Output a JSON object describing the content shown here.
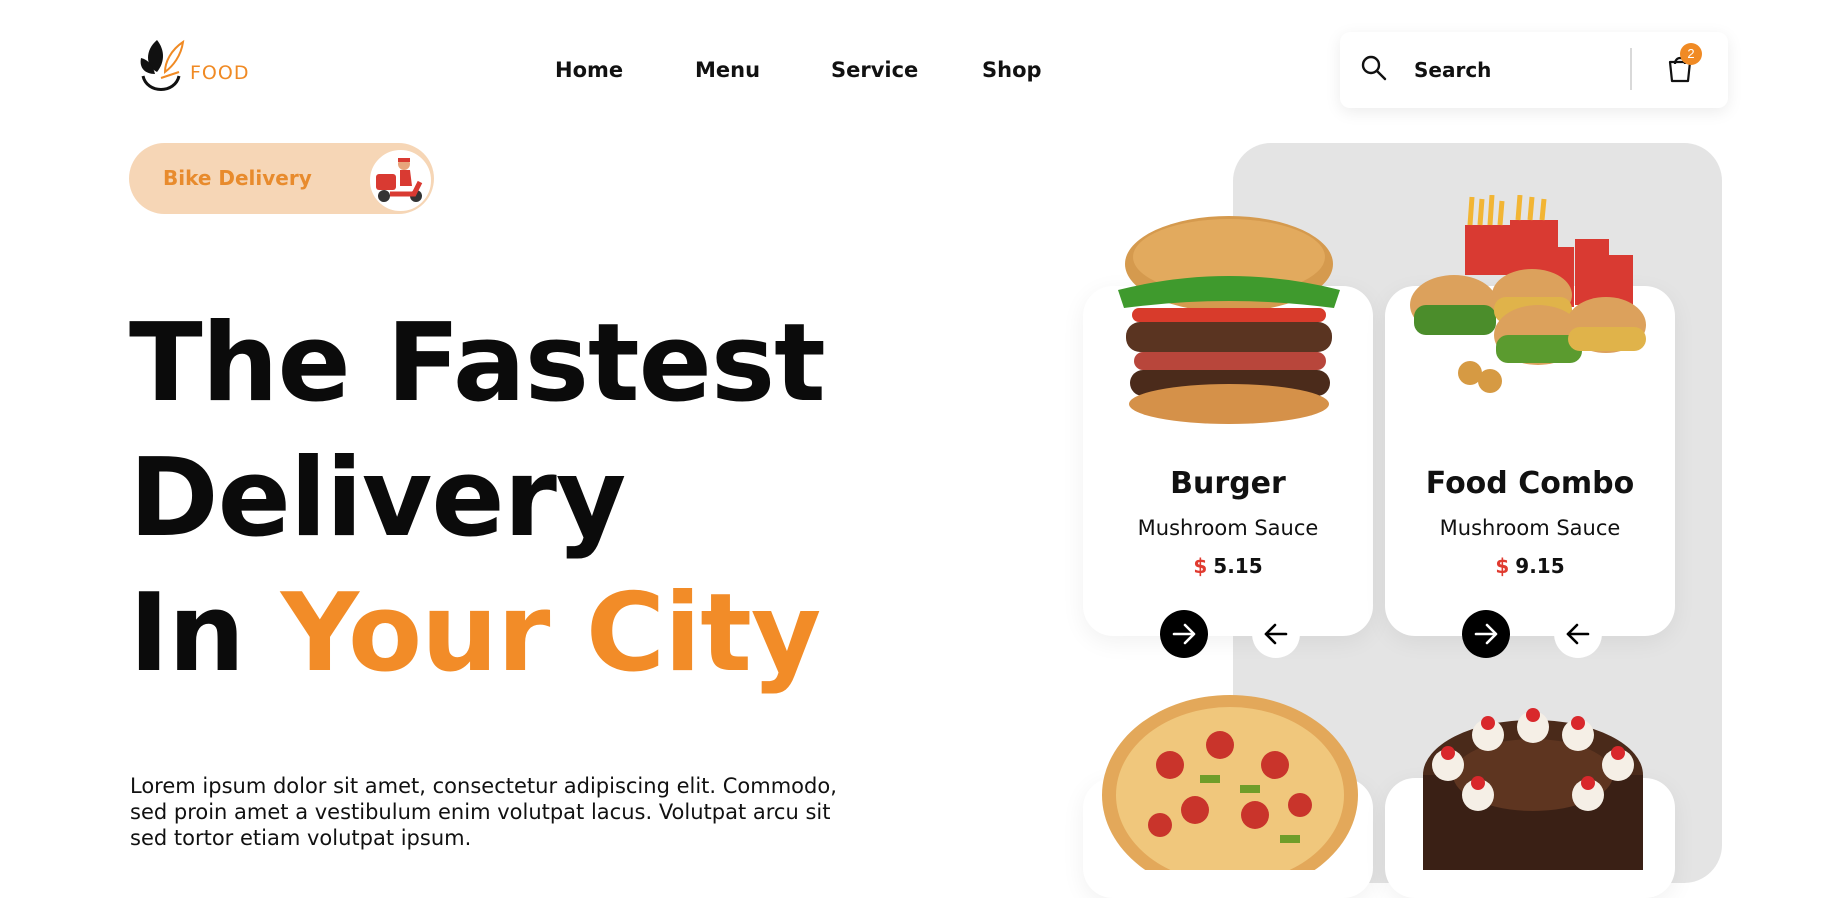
{
  "brand": {
    "logo_text": "FOOD"
  },
  "nav": [
    {
      "label": "Home"
    },
    {
      "label": "Menu"
    },
    {
      "label": "Service"
    },
    {
      "label": "Shop"
    }
  ],
  "search": {
    "placeholder": "Search",
    "icon": "search-icon"
  },
  "cart": {
    "count": "2",
    "icon": "shopping-bag-icon"
  },
  "badge": {
    "label": "Bike Delivery",
    "icon": "delivery-scooter-avatar"
  },
  "hero": {
    "line1": "The Fastest",
    "line2": "Delivery",
    "line3_prefix": "In",
    "line3_accent": "Your City",
    "description": "Lorem ipsum dolor sit amet, consectetur adipiscing elit. Commodo, sed proin amet a vestibulum enim volutpat lacus. Volutpat arcu sit sed tortor etiam volutpat ipsum."
  },
  "products": [
    {
      "name": "Burger",
      "subtitle": "Mushroom Sauce",
      "currency": "$",
      "price": "5.15"
    },
    {
      "name": "Food Combo",
      "subtitle": "Mushroom Sauce",
      "currency": "$",
      "price": "9.15"
    }
  ],
  "colors": {
    "accent": "#f28c28",
    "pill_bg": "#f6d6b6",
    "panel_bg": "#e4e4e4",
    "price_currency": "#e03a2f"
  }
}
